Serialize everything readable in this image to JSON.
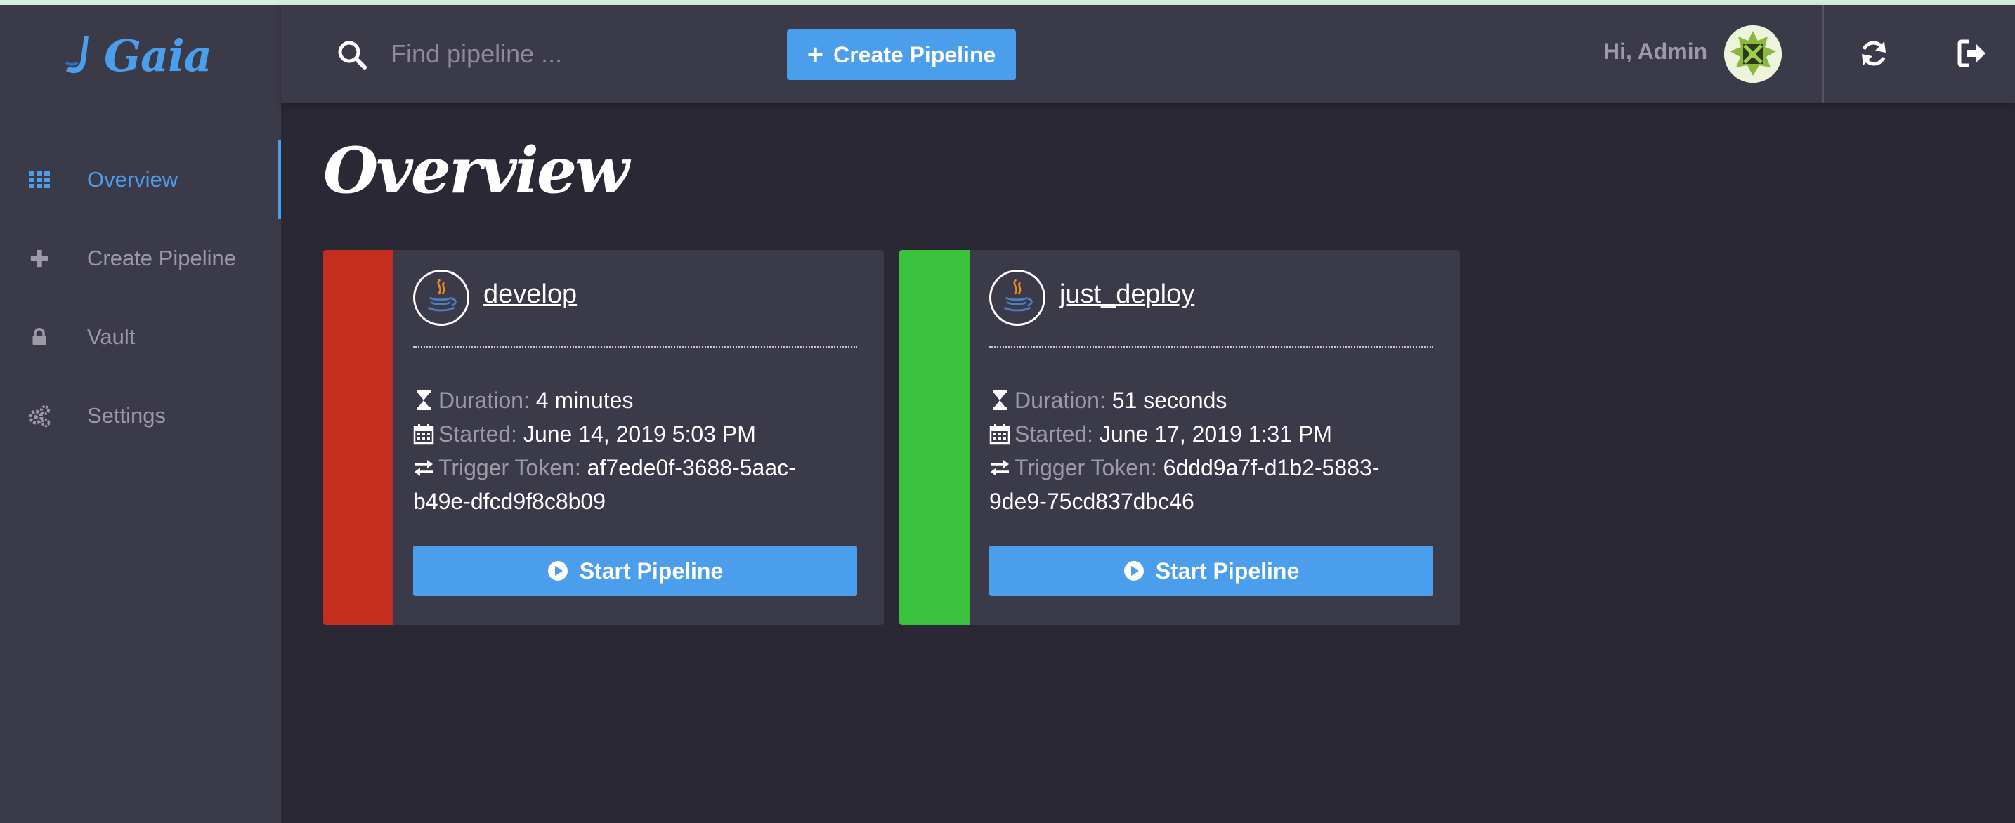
{
  "app": {
    "logo_text": "Gaia"
  },
  "colors": {
    "accent": "#4b9eec",
    "failed": "#c52d1e",
    "success": "#3ac23e",
    "panel": "#3b3a48",
    "background": "#2a2835"
  },
  "sidebar": {
    "items": [
      {
        "label": "Overview",
        "icon": "grid-icon",
        "active": true
      },
      {
        "label": "Create Pipeline",
        "icon": "plus-icon",
        "active": false
      },
      {
        "label": "Vault",
        "icon": "lock-icon",
        "active": false
      },
      {
        "label": "Settings",
        "icon": "gears-icon",
        "active": false
      }
    ]
  },
  "header": {
    "search_placeholder": "Find pipeline ...",
    "create_label": "Create Pipeline",
    "greeting": "Hi, Admin"
  },
  "main": {
    "title": "Overview",
    "pipelines": [
      {
        "name": "develop",
        "status_color": "#c52d1e",
        "duration_label": "Duration:",
        "duration": "4 minutes",
        "started_label": "Started:",
        "started": "June 14, 2019 5:03 PM",
        "token_label": "Trigger Token:",
        "token_line1": "af7ede0f-3688-5aac-",
        "token_line2": "b49e-dfcd9f8c8b09",
        "start_label": "Start Pipeline"
      },
      {
        "name": "just_deploy",
        "status_color": "#3ac23e",
        "duration_label": "Duration:",
        "duration": "51 seconds",
        "started_label": "Started:",
        "started": "June 17, 2019 1:31 PM",
        "token_label": "Trigger Token:",
        "token_line1": "6ddd9a7f-d1b2-5883-",
        "token_line2": "9de9-75cd837dbc46",
        "start_label": "Start Pipeline"
      }
    ]
  }
}
